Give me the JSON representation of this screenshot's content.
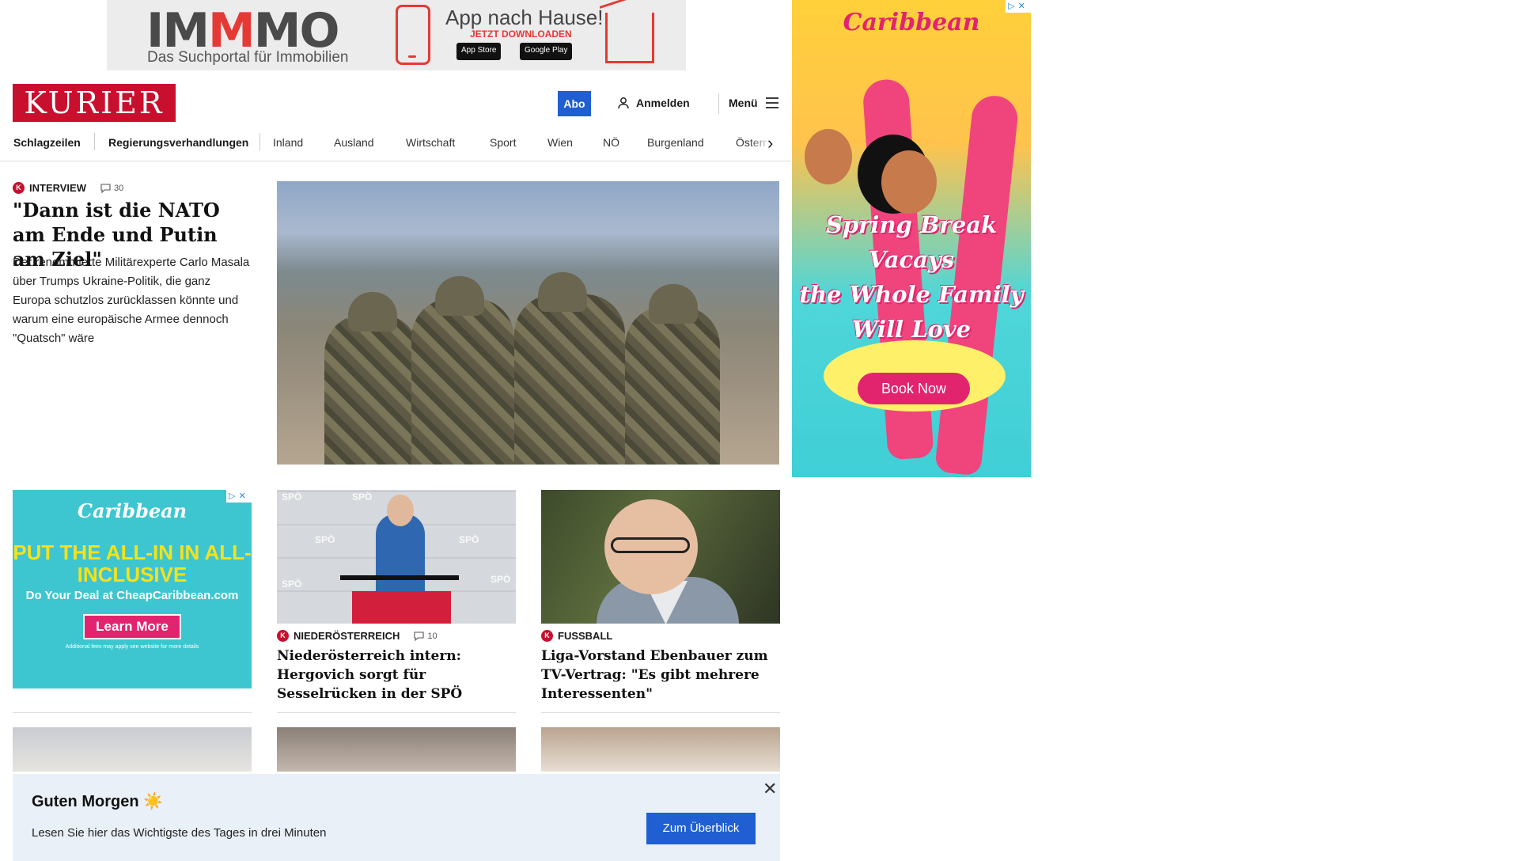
{
  "top_ad": {
    "logo_pre": "IM",
    "logo_m": "M",
    "logo_post": "MO",
    "tagline": "Das Suchportal für Immobilien",
    "headline": "App nach Hause!",
    "cta": "JETZT DOWNLOADEN",
    "store_ios": "App Store",
    "store_android": "Google Play"
  },
  "header": {
    "logo": "KURIER",
    "abo": "Abo",
    "login": "Anmelden",
    "menu": "Menü"
  },
  "nav": {
    "items": [
      "Schlagzeilen",
      "Regierungsverhandlungen",
      "Inland",
      "Ausland",
      "Wirtschaft",
      "Sport",
      "Wien",
      "NÖ",
      "Burgenland",
      "Österr"
    ]
  },
  "hero": {
    "kicker": "INTERVIEW",
    "comments": "30",
    "title": "\"Dann ist die NATO am Ende und Putin am Ziel\"",
    "text": "Der renommierte Militärexperte Carlo Masala über Trumps Ukraine-Politik, die ganz Europa schutzlos zurücklassen könnte und warum eine europäische Armee dennoch \"Quatsch\" wäre"
  },
  "ad_left": {
    "brand": "Caribbean",
    "headline": "PUT THE ALL-IN IN ALL-INCLUSIVE",
    "sub": "Do Your Deal at CheapCaribbean.com",
    "button": "Learn More",
    "fine": "Additional fees may apply see website for more details"
  },
  "cards": [
    {
      "kicker": "NIEDERÖSTERREICH",
      "comments": "10",
      "title": "Niederösterreich intern: Hergovich sorgt für Sesselrücken in der SPÖ",
      "image_label": "SPÖ"
    },
    {
      "kicker": "FUSSBALL",
      "title": "Liga-Vorstand Ebenbauer zum TV-Vertrag: \"Es gibt mehrere Interessenten\""
    }
  ],
  "ad_right": {
    "brand": "Caribbean",
    "slogan_1": "Spring Break Vacays",
    "slogan_2": "the Whole Family",
    "slogan_3": "Will Love",
    "button": "Book Now"
  },
  "toast": {
    "title": "Guten Morgen ☀️",
    "text": "Lesen Sie hier das Wichtigste des Tages in drei Minuten",
    "button": "Zum Überblick"
  },
  "colors": {
    "brand_red": "#c8102e",
    "accent_blue": "#1f5fd1",
    "toast_bg": "#eaf0f8"
  }
}
